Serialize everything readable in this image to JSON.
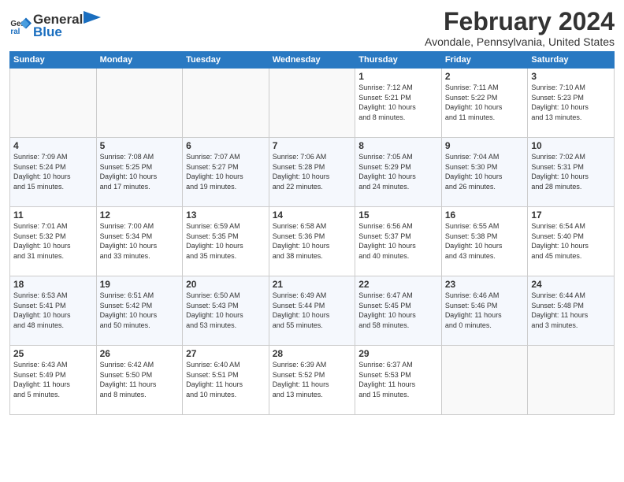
{
  "header": {
    "logo_text_general": "General",
    "logo_text_blue": "Blue",
    "month_title": "February 2024",
    "location": "Avondale, Pennsylvania, United States"
  },
  "days_of_week": [
    "Sunday",
    "Monday",
    "Tuesday",
    "Wednesday",
    "Thursday",
    "Friday",
    "Saturday"
  ],
  "weeks": [
    [
      {
        "num": "",
        "info": ""
      },
      {
        "num": "",
        "info": ""
      },
      {
        "num": "",
        "info": ""
      },
      {
        "num": "",
        "info": ""
      },
      {
        "num": "1",
        "info": "Sunrise: 7:12 AM\nSunset: 5:21 PM\nDaylight: 10 hours\nand 8 minutes."
      },
      {
        "num": "2",
        "info": "Sunrise: 7:11 AM\nSunset: 5:22 PM\nDaylight: 10 hours\nand 11 minutes."
      },
      {
        "num": "3",
        "info": "Sunrise: 7:10 AM\nSunset: 5:23 PM\nDaylight: 10 hours\nand 13 minutes."
      }
    ],
    [
      {
        "num": "4",
        "info": "Sunrise: 7:09 AM\nSunset: 5:24 PM\nDaylight: 10 hours\nand 15 minutes."
      },
      {
        "num": "5",
        "info": "Sunrise: 7:08 AM\nSunset: 5:25 PM\nDaylight: 10 hours\nand 17 minutes."
      },
      {
        "num": "6",
        "info": "Sunrise: 7:07 AM\nSunset: 5:27 PM\nDaylight: 10 hours\nand 19 minutes."
      },
      {
        "num": "7",
        "info": "Sunrise: 7:06 AM\nSunset: 5:28 PM\nDaylight: 10 hours\nand 22 minutes."
      },
      {
        "num": "8",
        "info": "Sunrise: 7:05 AM\nSunset: 5:29 PM\nDaylight: 10 hours\nand 24 minutes."
      },
      {
        "num": "9",
        "info": "Sunrise: 7:04 AM\nSunset: 5:30 PM\nDaylight: 10 hours\nand 26 minutes."
      },
      {
        "num": "10",
        "info": "Sunrise: 7:02 AM\nSunset: 5:31 PM\nDaylight: 10 hours\nand 28 minutes."
      }
    ],
    [
      {
        "num": "11",
        "info": "Sunrise: 7:01 AM\nSunset: 5:32 PM\nDaylight: 10 hours\nand 31 minutes."
      },
      {
        "num": "12",
        "info": "Sunrise: 7:00 AM\nSunset: 5:34 PM\nDaylight: 10 hours\nand 33 minutes."
      },
      {
        "num": "13",
        "info": "Sunrise: 6:59 AM\nSunset: 5:35 PM\nDaylight: 10 hours\nand 35 minutes."
      },
      {
        "num": "14",
        "info": "Sunrise: 6:58 AM\nSunset: 5:36 PM\nDaylight: 10 hours\nand 38 minutes."
      },
      {
        "num": "15",
        "info": "Sunrise: 6:56 AM\nSunset: 5:37 PM\nDaylight: 10 hours\nand 40 minutes."
      },
      {
        "num": "16",
        "info": "Sunrise: 6:55 AM\nSunset: 5:38 PM\nDaylight: 10 hours\nand 43 minutes."
      },
      {
        "num": "17",
        "info": "Sunrise: 6:54 AM\nSunset: 5:40 PM\nDaylight: 10 hours\nand 45 minutes."
      }
    ],
    [
      {
        "num": "18",
        "info": "Sunrise: 6:53 AM\nSunset: 5:41 PM\nDaylight: 10 hours\nand 48 minutes."
      },
      {
        "num": "19",
        "info": "Sunrise: 6:51 AM\nSunset: 5:42 PM\nDaylight: 10 hours\nand 50 minutes."
      },
      {
        "num": "20",
        "info": "Sunrise: 6:50 AM\nSunset: 5:43 PM\nDaylight: 10 hours\nand 53 minutes."
      },
      {
        "num": "21",
        "info": "Sunrise: 6:49 AM\nSunset: 5:44 PM\nDaylight: 10 hours\nand 55 minutes."
      },
      {
        "num": "22",
        "info": "Sunrise: 6:47 AM\nSunset: 5:45 PM\nDaylight: 10 hours\nand 58 minutes."
      },
      {
        "num": "23",
        "info": "Sunrise: 6:46 AM\nSunset: 5:46 PM\nDaylight: 11 hours\nand 0 minutes."
      },
      {
        "num": "24",
        "info": "Sunrise: 6:44 AM\nSunset: 5:48 PM\nDaylight: 11 hours\nand 3 minutes."
      }
    ],
    [
      {
        "num": "25",
        "info": "Sunrise: 6:43 AM\nSunset: 5:49 PM\nDaylight: 11 hours\nand 5 minutes."
      },
      {
        "num": "26",
        "info": "Sunrise: 6:42 AM\nSunset: 5:50 PM\nDaylight: 11 hours\nand 8 minutes."
      },
      {
        "num": "27",
        "info": "Sunrise: 6:40 AM\nSunset: 5:51 PM\nDaylight: 11 hours\nand 10 minutes."
      },
      {
        "num": "28",
        "info": "Sunrise: 6:39 AM\nSunset: 5:52 PM\nDaylight: 11 hours\nand 13 minutes."
      },
      {
        "num": "29",
        "info": "Sunrise: 6:37 AM\nSunset: 5:53 PM\nDaylight: 11 hours\nand 15 minutes."
      },
      {
        "num": "",
        "info": ""
      },
      {
        "num": "",
        "info": ""
      }
    ]
  ]
}
